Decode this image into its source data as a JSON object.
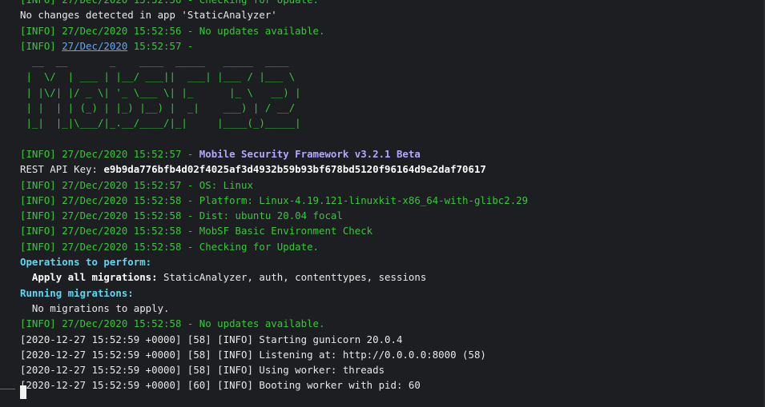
{
  "terminal": {
    "line_0": "[INFO] 27/Dec/2020 15:52:56 - Checking for Update.",
    "line_1": "No changes detected in app 'StaticAnalyzer'",
    "line_2": "[INFO] 27/Dec/2020 15:52:56 - No updates available.",
    "line_3_prefix": "[INFO] ",
    "line_3_link": "27/Dec/2020",
    "line_3_suffix": " 15:52:57 -",
    "banner": [
      "  __  __       _    ____  _____   _____  ____",
      " |  \\/  | ___ | |__/ ___||  ___| |___ / |___ \\",
      " | |\\/| |/ _ \\| '_ \\___ \\| |_      |_ \\   __) |",
      " | |  | | (_) | |_) |__) |  _|    ___) | / __/",
      " |_|  |_|\\___/|_.__/____/|_|     |____(_)_____|"
    ],
    "line_4_prefix": "[INFO] 27/Dec/2020 15:52:57 - ",
    "line_4_highlight": "Mobile Security Framework v3.2.1 Beta",
    "line_5_prefix": "REST API Key: ",
    "line_5_key": "e9b9da776bfb4d02f4025af3d4932b59b93bf678bd5120f96164d9e2daf70617",
    "line_6": "[INFO] 27/Dec/2020 15:52:57 - OS: Linux",
    "line_7": "[INFO] 27/Dec/2020 15:52:58 - Platform: Linux-4.19.121-linuxkit-x86_64-with-glibc2.29",
    "line_8": "[INFO] 27/Dec/2020 15:52:58 - Dist: ubuntu 20.04 focal",
    "line_9": "[INFO] 27/Dec/2020 15:52:58 - MobSF Basic Environment Check",
    "line_10": "[INFO] 27/Dec/2020 15:52:58 - Checking for Update.",
    "line_11": "Operations to perform:",
    "line_12_label": "  Apply all migrations: ",
    "line_12_value": "StaticAnalyzer, auth, contenttypes, sessions",
    "line_13": "Running migrations:",
    "line_14": "  No migrations to apply.",
    "line_15": "[INFO] 27/Dec/2020 15:52:58 - No updates available.",
    "line_16": "[2020-12-27 15:52:59 +0000] [58] [INFO] Starting gunicorn 20.0.4",
    "line_17": "[2020-12-27 15:52:59 +0000] [58] [INFO] Listening at: http://0.0.0.0:8000 (58)",
    "line_18": "[2020-12-27 15:52:59 +0000] [58] [INFO] Using worker: threads",
    "line_19": "[2020-12-27 15:52:59 +0000] [60] [INFO] Booting worker with pid: 60"
  },
  "colors": {
    "background": "#1c1e21",
    "info_green": "#36c83b",
    "heading_cyan": "#5fd7f2",
    "highlight_lavender": "#b4a6ff",
    "text_white": "#e8e8e8"
  }
}
